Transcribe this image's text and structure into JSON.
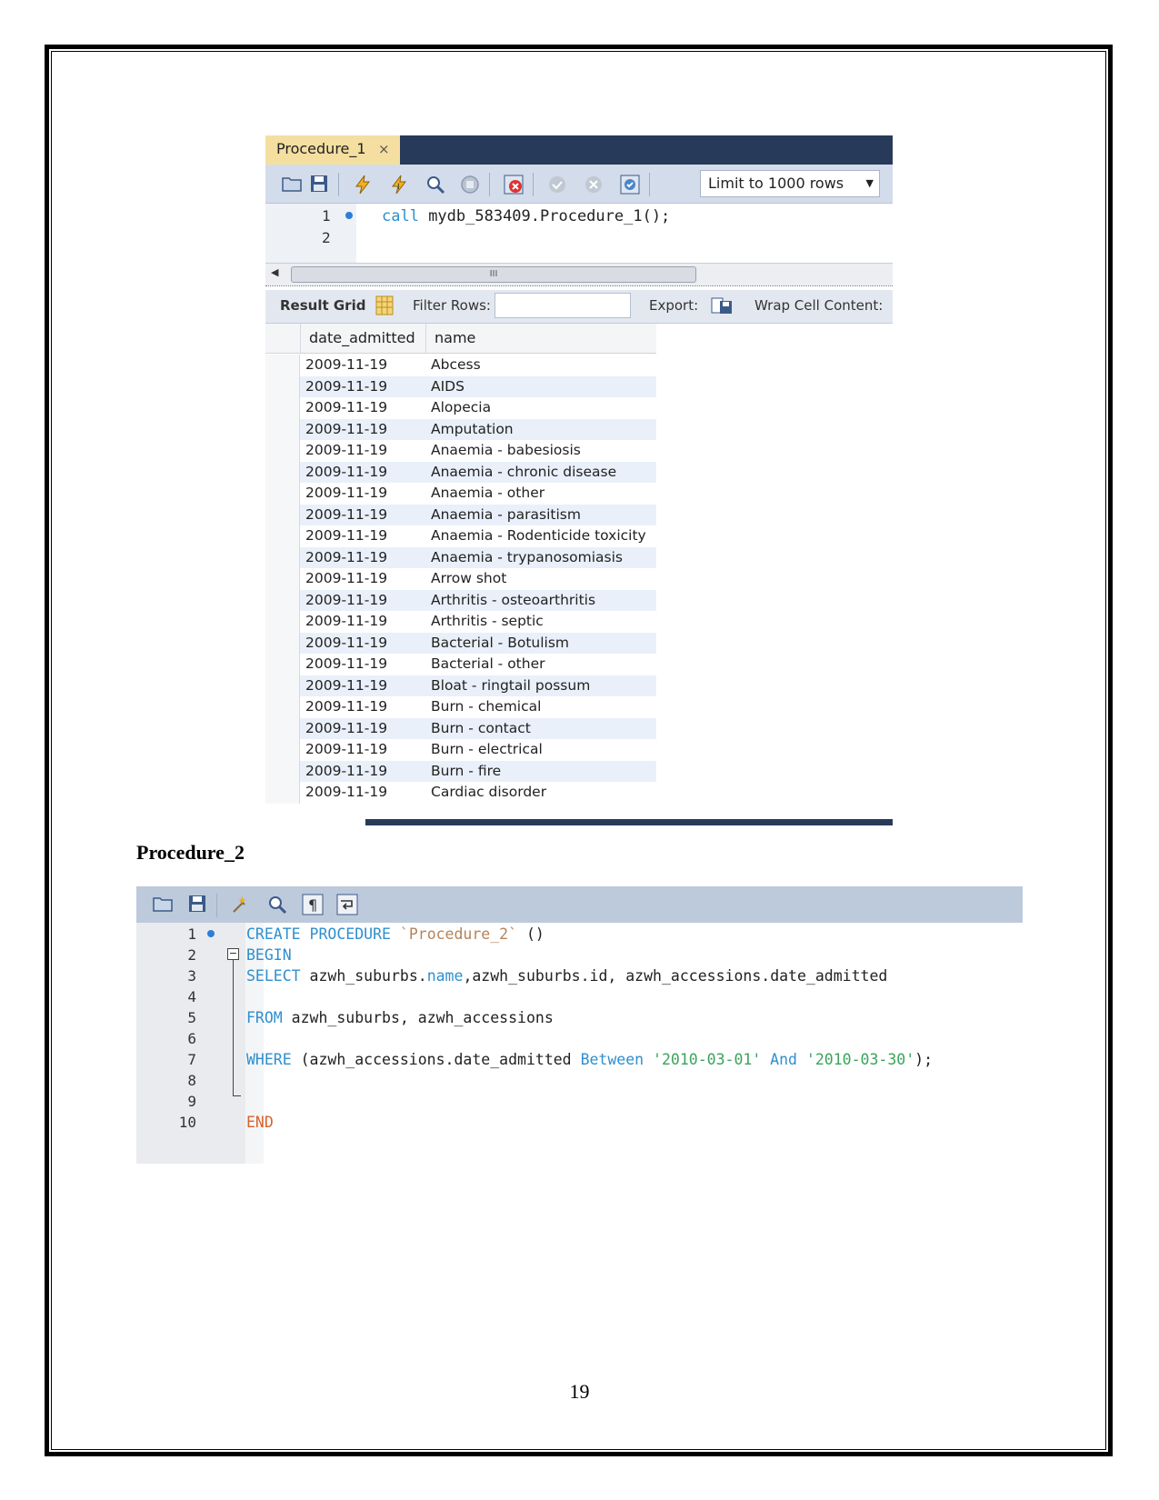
{
  "procedure1": {
    "tab_title": "Procedure_1",
    "tab_close": "×",
    "limit_label": "Limit to 1000 rows",
    "line_numbers": [
      "1",
      "2"
    ],
    "code_keyword": "call",
    "code_rest": " mydb_583409.Procedure_1();",
    "scroll_thumb": "III",
    "result_grid_label": "Result Grid",
    "filter_rows_label": "Filter Rows:",
    "export_label": "Export:",
    "wrap_label": "Wrap Cell Content:",
    "columns": [
      "date_admitted",
      "name"
    ],
    "rows": [
      [
        "2009-11-19",
        "Abcess"
      ],
      [
        "2009-11-19",
        "AIDS"
      ],
      [
        "2009-11-19",
        "Alopecia"
      ],
      [
        "2009-11-19",
        "Amputation"
      ],
      [
        "2009-11-19",
        "Anaemia - babesiosis"
      ],
      [
        "2009-11-19",
        "Anaemia - chronic disease"
      ],
      [
        "2009-11-19",
        "Anaemia - other"
      ],
      [
        "2009-11-19",
        "Anaemia - parasitism"
      ],
      [
        "2009-11-19",
        "Anaemia - Rodenticide toxicity"
      ],
      [
        "2009-11-19",
        "Anaemia - trypanosomiasis"
      ],
      [
        "2009-11-19",
        "Arrow shot"
      ],
      [
        "2009-11-19",
        "Arthritis - osteoarthritis"
      ],
      [
        "2009-11-19",
        "Arthritis - septic"
      ],
      [
        "2009-11-19",
        "Bacterial - Botulism"
      ],
      [
        "2009-11-19",
        "Bacterial - other"
      ],
      [
        "2009-11-19",
        "Bloat - ringtail possum"
      ],
      [
        "2009-11-19",
        "Burn - chemical"
      ],
      [
        "2009-11-19",
        "Burn - contact"
      ],
      [
        "2009-11-19",
        "Burn - electrical"
      ],
      [
        "2009-11-19",
        "Burn - fire"
      ],
      [
        "2009-11-19",
        "Cardiac disorder"
      ]
    ]
  },
  "heading": "Procedure_2",
  "procedure2": {
    "line_numbers": [
      "1",
      "2",
      "3",
      "4",
      "5",
      "6",
      "7",
      "8",
      "9",
      "10"
    ],
    "fold_symbol": "−",
    "lines": {
      "l1_kw": "CREATE PROCEDURE",
      "l1_name": " `Procedure_2` ",
      "l1_rest": "()",
      "l2_kw": "BEGIN",
      "l3_kw": "SELECT",
      "l3_a": " azwh_suburbs.",
      "l3_name": "name",
      "l3_b": ",azwh_suburbs.id, azwh_accessions.date_admitted",
      "l5_kw": "FROM",
      "l5_rest": " azwh_suburbs, azwh_accessions",
      "l7_kw": "WHERE",
      "l7_a": " (azwh_accessions.date_admitted ",
      "l7_between": "Between",
      "l7_s1": " '2010-03-01'",
      "l7_and": " And",
      "l7_s2": " '2010-03-30'",
      "l7_end": ");",
      "l10_kw": "END"
    }
  },
  "page_number": "19",
  "icons": {
    "toolbar1": [
      "folder-icon",
      "save-icon",
      "execute-icon",
      "execute-current-icon",
      "explain-icon",
      "stop-icon",
      "toggle-error-icon",
      "commit-icon",
      "rollback-icon",
      "autocommit-icon"
    ],
    "toolbar2": [
      "folder-icon",
      "save-icon",
      "beautify-icon",
      "find-icon",
      "invisible-chars-icon",
      "wrap-icon"
    ]
  },
  "colors": {
    "keyword": "#2f8fcf",
    "string": "#3aa35a",
    "end_keyword": "#d9622b",
    "tab_active": "#f5dfa0",
    "tab_bar": "#283a5a",
    "row_alt": "#eaf0fa"
  }
}
